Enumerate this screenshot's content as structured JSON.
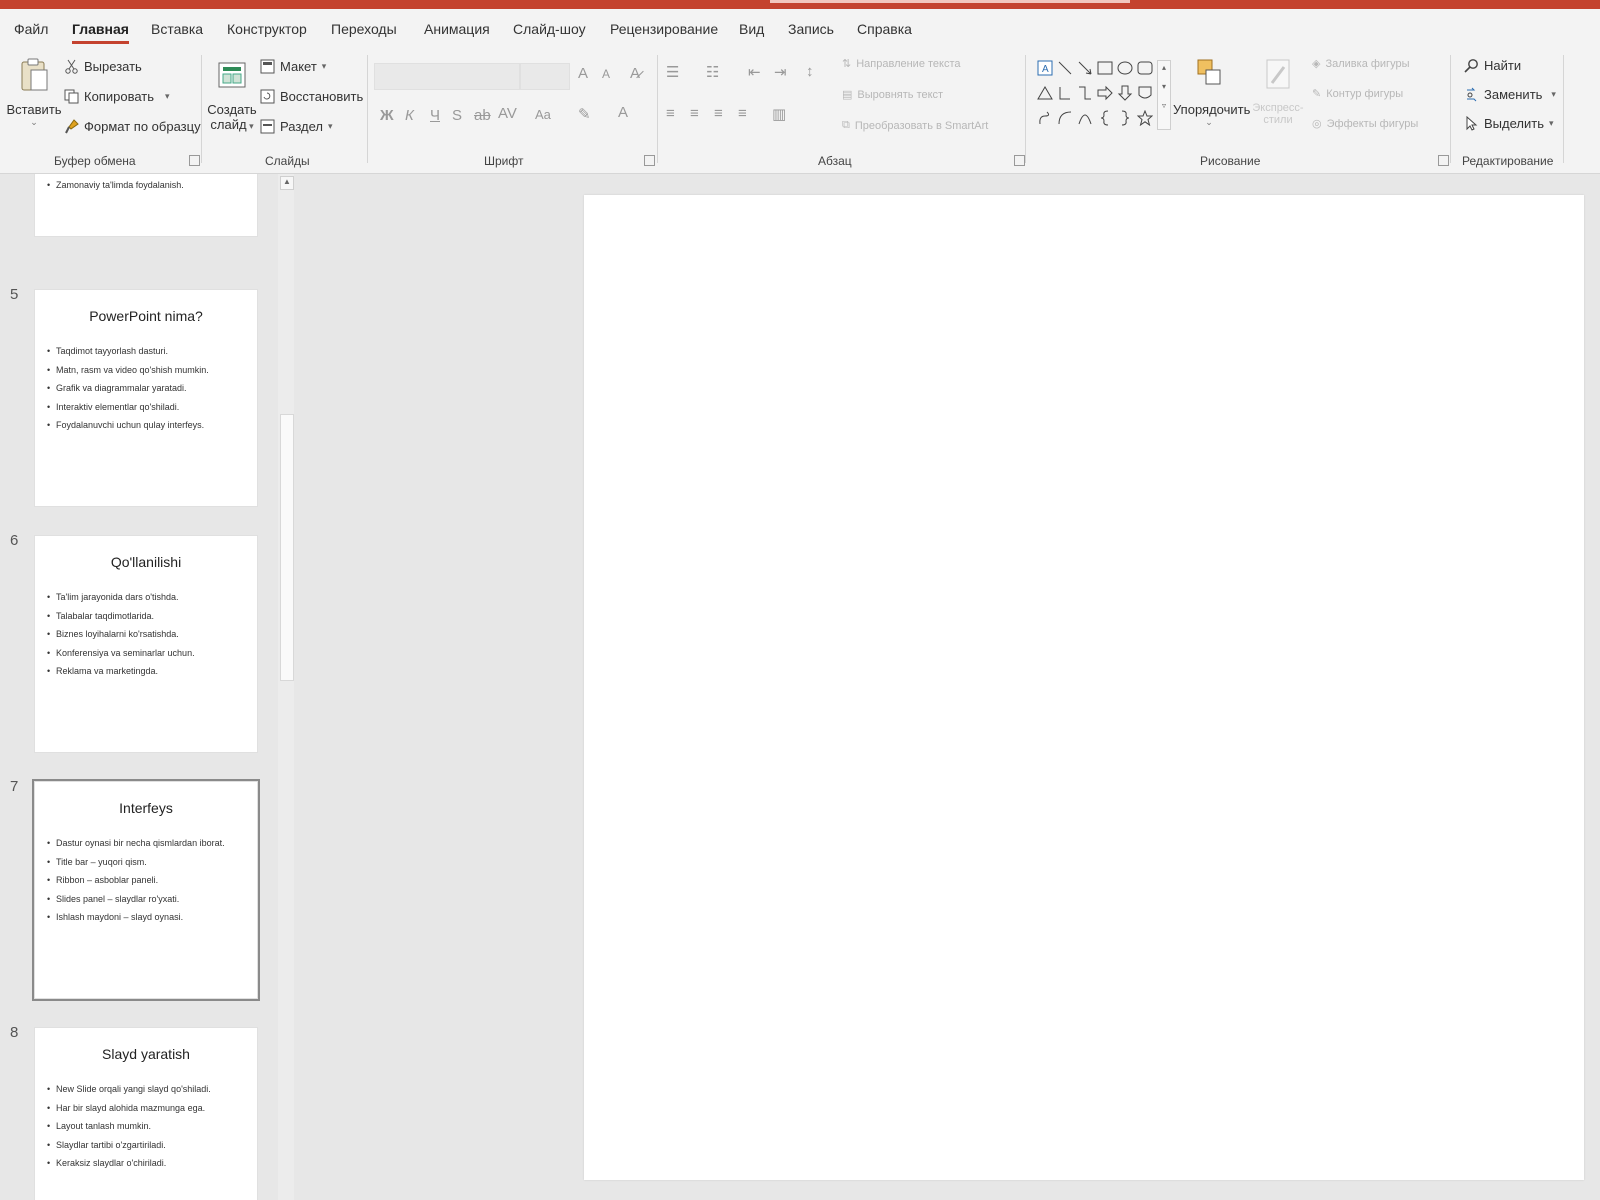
{
  "app": {
    "accent_color": "#c4422e"
  },
  "menu": {
    "tabs": [
      {
        "label": "Файл"
      },
      {
        "label": "Главная",
        "active": true
      },
      {
        "label": "Вставка"
      },
      {
        "label": "Конструктор"
      },
      {
        "label": "Переходы"
      },
      {
        "label": "Анимация"
      },
      {
        "label": "Слайд-шоу"
      },
      {
        "label": "Рецензирование"
      },
      {
        "label": "Вид"
      },
      {
        "label": "Запись"
      },
      {
        "label": "Справка"
      }
    ]
  },
  "ribbon": {
    "clipboard": {
      "group_label": "Буфер обмена",
      "paste": "Вставить",
      "cut": "Вырезать",
      "copy": "Копировать",
      "format_painter": "Формат по образцу"
    },
    "slides": {
      "group_label": "Слайды",
      "new_slide_line1": "Создать",
      "new_slide_line2": "слайд",
      "layout": "Макет",
      "reset": "Восстановить",
      "section": "Раздел"
    },
    "font": {
      "group_label": "Шрифт",
      "bold": "Ж",
      "italic": "К",
      "underline": "Ч",
      "strike": "S",
      "case": "Aa"
    },
    "paragraph": {
      "group_label": "Абзац",
      "text_direction": "Направление текста",
      "align_text": "Выровнять текст",
      "smartart": "Преобразовать в SmartArt"
    },
    "drawing": {
      "group_label": "Рисование",
      "arrange": "Упорядочить",
      "quick_styles_line1": "Экспресс-",
      "quick_styles_line2": "стили",
      "shape_fill": "Заливка фигуры",
      "shape_outline": "Контур фигуры",
      "shape_effects": "Эффекты фигуры"
    },
    "editing": {
      "group_label": "Редактирование",
      "find": "Найти",
      "replace": "Заменить",
      "select": "Выделить"
    }
  },
  "thumbnails": {
    "partial": {
      "bullet": "Zamonaviy ta'limda foydalanish."
    },
    "slides": [
      {
        "number": "5",
        "title": "PowerPoint nima?",
        "bullets": [
          "Taqdimot tayyorlash dasturi.",
          "Matn, rasm va video qo'shish mumkin.",
          "Grafik va diagrammalar yaratadi.",
          "Interaktiv elementlar qo'shiladi.",
          "Foydalanuvchi uchun qulay interfeys."
        ]
      },
      {
        "number": "6",
        "title": "Qo'llanilishi",
        "bullets": [
          "Ta'lim jarayonida dars o'tishda.",
          "Talabalar taqdimotlarida.",
          "Biznes loyihalarni ko'rsatishda.",
          "Konferensiya va seminarlar uchun.",
          "Reklama va marketingda."
        ]
      },
      {
        "number": "7",
        "title": "Interfeys",
        "selected": true,
        "bullets": [
          "Dastur oynasi bir necha qismlardan iborat.",
          "Title bar – yuqori qism.",
          "Ribbon – asboblar paneli.",
          "Slides panel – slaydlar ro'yxati.",
          "Ishlash maydoni – slayd oynasi."
        ]
      },
      {
        "number": "8",
        "title": "Slayd yaratish",
        "bullets": [
          "New Slide orqali yangi slayd qo'shiladi.",
          "Har bir slayd alohida mazmunga ega.",
          "Layout tanlash mumkin.",
          "Slaydlar tartibi o'zgartiriladi.",
          "Keraksiz slaydlar o'chiriladi."
        ]
      }
    ]
  }
}
